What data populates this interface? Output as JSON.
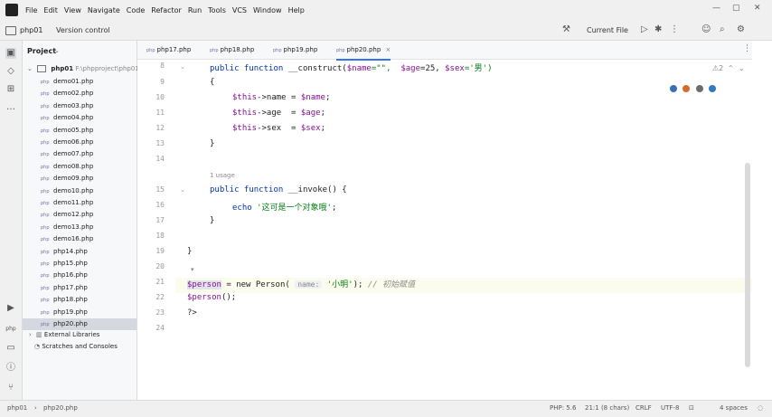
{
  "menu": [
    "File",
    "Edit",
    "View",
    "Navigate",
    "Code",
    "Refactor",
    "Run",
    "Tools",
    "VCS",
    "Window",
    "Help"
  ],
  "toolbar": {
    "project_name": "php01",
    "version_control": "Version control",
    "run_config": "Current File"
  },
  "project_panel": {
    "title": "Project",
    "root": "php01",
    "root_path": "F:\\phpproject\\php01",
    "files": [
      "demo01.php",
      "demo02.php",
      "demo03.php",
      "demo04.php",
      "demo05.php",
      "demo06.php",
      "demo07.php",
      "demo08.php",
      "demo09.php",
      "demo10.php",
      "demo11.php",
      "demo12.php",
      "demo13.php",
      "demo16.php",
      "php14.php",
      "php15.php",
      "php16.php",
      "php17.php",
      "php18.php",
      "php19.php",
      "php20.php"
    ],
    "selected_file": "php20.php",
    "external": "External Libraries",
    "scratches": "Scratches and Consoles"
  },
  "tabs": [
    "php17.php",
    "php18.php",
    "php19.php",
    "php20.php"
  ],
  "active_tab": "php20.php",
  "editor": {
    "line_numbers": [
      "8",
      "9",
      "10",
      "11",
      "12",
      "13",
      "14",
      "15",
      "16",
      "17",
      "18",
      "19",
      "20",
      "21",
      "22",
      "23",
      "24"
    ],
    "usages_hint": "1 usage",
    "param_hint": "name:",
    "inspection_count": "2",
    "lines": {
      "l8_kw": "public function ",
      "l8_name": "__construct(",
      "l8_p1": "$name",
      "l8_d1": "=\"\",  ",
      "l8_p2": "$age",
      "l8_d2": "=25, ",
      "l8_p3": "$sex",
      "l8_d3": "='男')",
      "l9": "{",
      "l10_a": "$this",
      "l10_b": "->name = ",
      "l10_c": "$name",
      "l10_d": ";",
      "l11_a": "$this",
      "l11_b": "->age  = ",
      "l11_c": "$age",
      "l11_d": ";",
      "l12_a": "$this",
      "l12_b": "->sex  = ",
      "l12_c": "$sex",
      "l12_d": ";",
      "l13": "}",
      "l15_kw": "public function ",
      "l15_name": "__invoke() {",
      "l16_kw": "echo ",
      "l16_str": "'这可是一个对象哦'",
      "l16_end": ";",
      "l17": "}",
      "l19": "}",
      "l21_var": "$person",
      "l21_mid": " = new Person( ",
      "l21_str": "'小明'",
      "l21_end": "); ",
      "l21_cm": "// 初始赋值",
      "l22_var": "$person",
      "l22_end": "();",
      "l23": "?>"
    }
  },
  "statusbar": {
    "crumb_project": "php01",
    "crumb_file": "php20.php",
    "php_version": "PHP: 5.6",
    "position": "21:1 (8 chars)",
    "line_sep": "CRLF",
    "encoding": "UTF-8",
    "indent": "4 spaces"
  }
}
